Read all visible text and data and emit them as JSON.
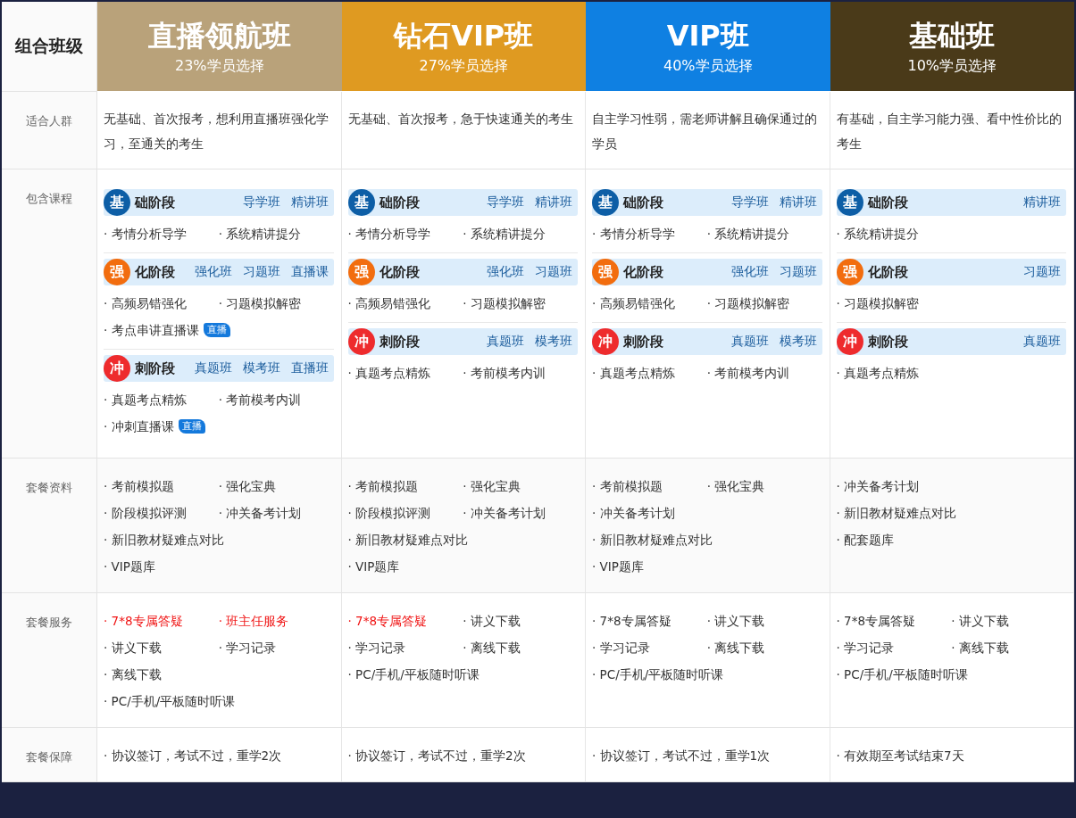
{
  "corner": "组合班级",
  "plans": [
    {
      "title": "直播领航班",
      "subtitle": "23%学员选择",
      "color": "#b9a27a"
    },
    {
      "title": "钻石VIP班",
      "subtitle": "27%学员选择",
      "color": "#df9a21"
    },
    {
      "title": "VIP班",
      "subtitle": "40%学员选择",
      "color": "#0f80e2"
    },
    {
      "title": "基础班",
      "subtitle": "10%学员选择",
      "color": "#4a3a19"
    }
  ],
  "rows": [
    {
      "kind": "text",
      "label": "适合人群",
      "cells": [
        "无基础、首次报考，想利用直播班强化学习，至通关的考生",
        "无基础、首次报考，急于快速通关的考生",
        "自主学习性弱，需老师讲解且确保通过的学员",
        "有基础，自主学习能力强、看中性价比的考生"
      ]
    },
    {
      "kind": "courses",
      "label": "包含课程",
      "cells": [
        [
          {
            "kind": "base",
            "badge": "基",
            "title": "础阶段",
            "classes": [
              "导学班",
              "精讲班"
            ],
            "items": [
              {
                "text": "· 考情分析导学"
              },
              {
                "text": "· 系统精讲提分"
              }
            ]
          },
          {
            "kind": "strengthen",
            "badge": "强",
            "title": "化阶段",
            "classes": [
              "强化班",
              "习题班",
              "直播课"
            ],
            "items": [
              {
                "text": "· 高频易错强化"
              },
              {
                "text": "· 习题模拟解密"
              },
              {
                "text": "· 考点串讲直播课",
                "tag": "直播"
              }
            ]
          },
          {
            "kind": "sprint",
            "badge": "冲",
            "title": "刺阶段",
            "classes": [
              "真题班",
              "模考班",
              "直播班"
            ],
            "items": [
              {
                "text": "· 真题考点精炼"
              },
              {
                "text": "· 考前模考内训"
              },
              {
                "text": "· 冲刺直播课",
                "tag": "直播"
              }
            ]
          }
        ],
        [
          {
            "kind": "base",
            "badge": "基",
            "title": "础阶段",
            "classes": [
              "导学班",
              "精讲班"
            ],
            "items": [
              {
                "text": "· 考情分析导学"
              },
              {
                "text": "· 系统精讲提分"
              }
            ]
          },
          {
            "kind": "strengthen",
            "badge": "强",
            "title": "化阶段",
            "classes": [
              "强化班",
              "习题班"
            ],
            "items": [
              {
                "text": "· 高频易错强化"
              },
              {
                "text": "· 习题模拟解密"
              }
            ]
          },
          {
            "kind": "sprint",
            "badge": "冲",
            "title": "刺阶段",
            "classes": [
              "真题班",
              "模考班"
            ],
            "items": [
              {
                "text": "· 真题考点精炼"
              },
              {
                "text": "· 考前模考内训"
              }
            ]
          }
        ],
        [
          {
            "kind": "base",
            "badge": "基",
            "title": "础阶段",
            "classes": [
              "导学班",
              "精讲班"
            ],
            "items": [
              {
                "text": "· 考情分析导学"
              },
              {
                "text": "· 系统精讲提分"
              }
            ]
          },
          {
            "kind": "strengthen",
            "badge": "强",
            "title": "化阶段",
            "classes": [
              "强化班",
              "习题班"
            ],
            "items": [
              {
                "text": "· 高频易错强化"
              },
              {
                "text": "· 习题模拟解密"
              }
            ]
          },
          {
            "kind": "sprint",
            "badge": "冲",
            "title": "刺阶段",
            "classes": [
              "真题班",
              "模考班"
            ],
            "items": [
              {
                "text": "· 真题考点精炼"
              },
              {
                "text": "· 考前模考内训"
              }
            ]
          }
        ],
        [
          {
            "kind": "base",
            "badge": "基",
            "title": "础阶段",
            "classes": [
              "精讲班"
            ],
            "items": [
              {
                "text": "· 系统精讲提分"
              }
            ]
          },
          {
            "kind": "strengthen",
            "badge": "强",
            "title": "化阶段",
            "classes": [
              "习题班"
            ],
            "items": [
              {
                "text": "· 习题模拟解密"
              }
            ]
          },
          {
            "kind": "sprint",
            "badge": "冲",
            "title": "刺阶段",
            "classes": [
              "真题班"
            ],
            "items": [
              {
                "text": "· 真题考点精炼"
              }
            ]
          }
        ]
      ]
    },
    {
      "kind": "list",
      "label": "套餐资料",
      "cells": [
        [
          {
            "text": "· 考前模拟题"
          },
          {
            "text": "· 强化宝典"
          },
          {
            "text": "· 阶段模拟评测"
          },
          {
            "text": "· 冲关备考计划"
          },
          {
            "text": "· 新旧教材疑难点对比"
          },
          {
            "text": "· VIP题库"
          }
        ],
        [
          {
            "text": "· 考前模拟题"
          },
          {
            "text": "· 强化宝典"
          },
          {
            "text": "· 阶段模拟评测"
          },
          {
            "text": "· 冲关备考计划"
          },
          {
            "text": "· 新旧教材疑难点对比"
          },
          {
            "text": "· VIP题库"
          }
        ],
        [
          {
            "text": "· 考前模拟题"
          },
          {
            "text": "· 强化宝典"
          },
          {
            "text": "· 冲关备考计划"
          },
          {
            "text": "· 新旧教材疑难点对比"
          },
          {
            "text": "· VIP题库"
          }
        ],
        [
          {
            "text": "· 冲关备考计划"
          },
          {
            "text": "· 新旧教材疑难点对比"
          },
          {
            "text": "· 配套题库"
          }
        ]
      ]
    },
    {
      "kind": "list",
      "label": "套餐服务",
      "cells": [
        [
          {
            "text": "· 7*8专属答疑",
            "highlight": true
          },
          {
            "text": "· 班主任服务",
            "highlight": true
          },
          {
            "text": "· 讲义下载",
            "highlight": false
          },
          {
            "text": "· 学习记录",
            "highlight": false
          },
          {
            "text": "· 离线下载",
            "highlight": false
          },
          {
            "text": "· PC/手机/平板随时听课",
            "highlight": false
          }
        ],
        [
          {
            "text": "· 7*8专属答疑",
            "highlight": true
          },
          {
            "text": "· 讲义下载",
            "highlight": false
          },
          {
            "text": "· 学习记录",
            "highlight": false
          },
          {
            "text": "· 离线下载",
            "highlight": false
          },
          {
            "text": "· PC/手机/平板随时听课",
            "highlight": false
          }
        ],
        [
          {
            "text": "· 7*8专属答疑",
            "highlight": false
          },
          {
            "text": "· 讲义下载",
            "highlight": false
          },
          {
            "text": "· 学习记录",
            "highlight": false
          },
          {
            "text": "· 离线下载",
            "highlight": false
          },
          {
            "text": "· PC/手机/平板随时听课",
            "highlight": false
          }
        ],
        [
          {
            "text": "· 7*8专属答疑",
            "highlight": false
          },
          {
            "text": "· 讲义下载",
            "highlight": false
          },
          {
            "text": "· 学习记录",
            "highlight": false
          },
          {
            "text": "· 离线下载",
            "highlight": false
          },
          {
            "text": "· PC/手机/平板随时听课",
            "highlight": false
          }
        ]
      ]
    },
    {
      "kind": "list",
      "label": "套餐保障",
      "cells": [
        [
          {
            "text": "· 协议签订，考试不过，重学2次"
          }
        ],
        [
          {
            "text": "· 协议签订，考试不过，重学2次"
          }
        ],
        [
          {
            "text": "· 协议签订，考试不过，重学1次"
          }
        ],
        [
          {
            "text": "· 有效期至考试结束7天"
          }
        ]
      ]
    }
  ]
}
